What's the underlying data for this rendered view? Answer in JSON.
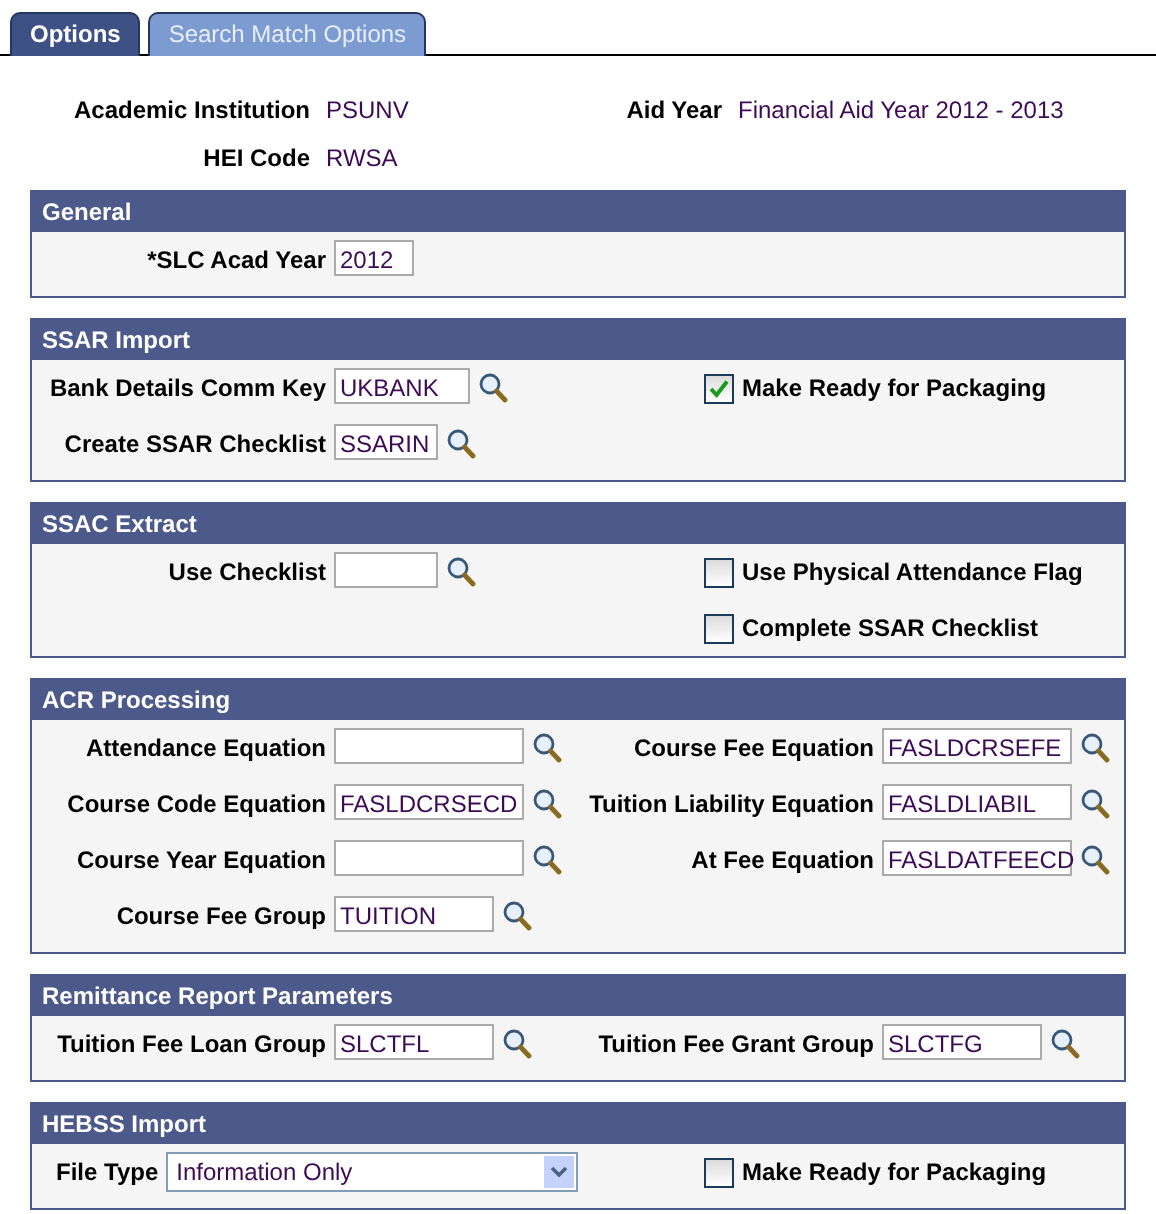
{
  "tabs": [
    {
      "label": "Options",
      "selected": true
    },
    {
      "label": "Search Match Options",
      "selected": false
    }
  ],
  "info": [
    {
      "label": "Academic Institution",
      "value": "PSUNV"
    },
    {
      "label": "Aid Year",
      "value": "Financial Aid Year 2012 - 2013"
    },
    {
      "label": "HEI Code",
      "value": "RWSA"
    }
  ],
  "sections": [
    {
      "title": "General",
      "rows": [
        {
          "left": {
            "kind": "text",
            "label": "*SLC Acad Year",
            "value": "2012"
          }
        }
      ]
    },
    {
      "title": "SSAR Import",
      "rows": [
        {
          "left": {
            "kind": "lookup",
            "label": "Bank Details Comm Key",
            "value": "UKBANK"
          },
          "right": {
            "kind": "checkbox",
            "label": "Make Ready for Packaging",
            "checked": true
          }
        },
        {
          "left": {
            "kind": "lookup",
            "label": "Create SSAR Checklist",
            "value": "SSARIN"
          }
        }
      ]
    },
    {
      "title": "SSAC Extract",
      "rows": [
        {
          "left": {
            "kind": "lookup",
            "label": "Use Checklist"
          },
          "right": {
            "kind": "checkbox",
            "label": "Use Physical Attendance Flag",
            "checked": false
          }
        },
        {
          "right": {
            "kind": "checkbox",
            "label": "Complete SSAR Checklist",
            "checked": false
          }
        }
      ]
    },
    {
      "title": "ACR Processing",
      "rows": [
        {
          "left": {
            "kind": "lookup",
            "label": "Attendance Equation"
          },
          "right": {
            "kind": "lookup",
            "label": "Course Fee Equation",
            "value": "FASLDCRSEFE"
          }
        },
        {
          "left": {
            "kind": "lookup",
            "label": "Course Code Equation",
            "value": "FASLDCRSECD"
          },
          "right": {
            "kind": "lookup",
            "label": "Tuition Liability Equation",
            "value": "FASLDLIABIL"
          }
        },
        {
          "left": {
            "kind": "lookup",
            "label": "Course Year Equation"
          },
          "right": {
            "kind": "lookup",
            "label": "At Fee Equation",
            "value": "FASLDATFEECD"
          }
        },
        {
          "left": {
            "kind": "lookup",
            "label": "Course Fee Group",
            "value": "TUITION"
          }
        }
      ]
    },
    {
      "title": "Remittance Report Parameters",
      "rows": [
        {
          "left": {
            "kind": "lookup",
            "label": "Tuition Fee Loan Group",
            "value": "SLCTFL"
          },
          "right": {
            "kind": "lookup",
            "label": "Tuition Fee Grant Group",
            "value": "SLCTFG"
          }
        }
      ]
    },
    {
      "title": "HEBSS Import",
      "rows": [
        {
          "left": {
            "kind": "select",
            "label": "File Type",
            "value": "Information Only"
          },
          "right": {
            "kind": "checkbox",
            "label": "Make Ready for Packaging",
            "checked": false
          }
        }
      ]
    }
  ]
}
